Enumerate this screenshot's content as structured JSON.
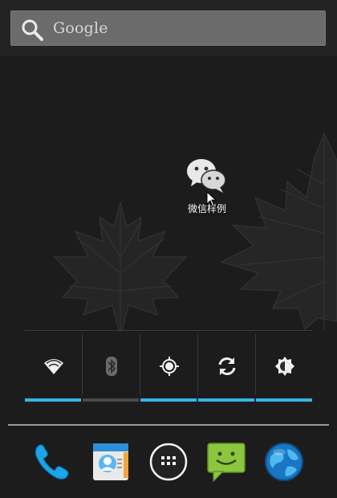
{
  "search": {
    "label": "Google",
    "icon": "search-icon"
  },
  "shortcut": {
    "label": "微信样例",
    "icon": "wechat-icon"
  },
  "power_widget": {
    "toggles": [
      {
        "name": "wifi",
        "icon": "wifi-icon",
        "on": true
      },
      {
        "name": "bluetooth",
        "icon": "bluetooth-icon",
        "on": false
      },
      {
        "name": "gps",
        "icon": "gps-icon",
        "on": true
      },
      {
        "name": "sync",
        "icon": "sync-icon",
        "on": true
      },
      {
        "name": "brightness",
        "icon": "brightness-icon",
        "on": true
      }
    ],
    "colors": {
      "on": "#33b5e5",
      "off": "#4a4a4a"
    }
  },
  "dock": [
    {
      "name": "phone",
      "icon": "phone-icon"
    },
    {
      "name": "contacts",
      "icon": "contacts-icon"
    },
    {
      "name": "all-apps",
      "icon": "app-drawer-icon"
    },
    {
      "name": "messaging",
      "icon": "messaging-icon"
    },
    {
      "name": "browser",
      "icon": "globe-icon"
    }
  ]
}
